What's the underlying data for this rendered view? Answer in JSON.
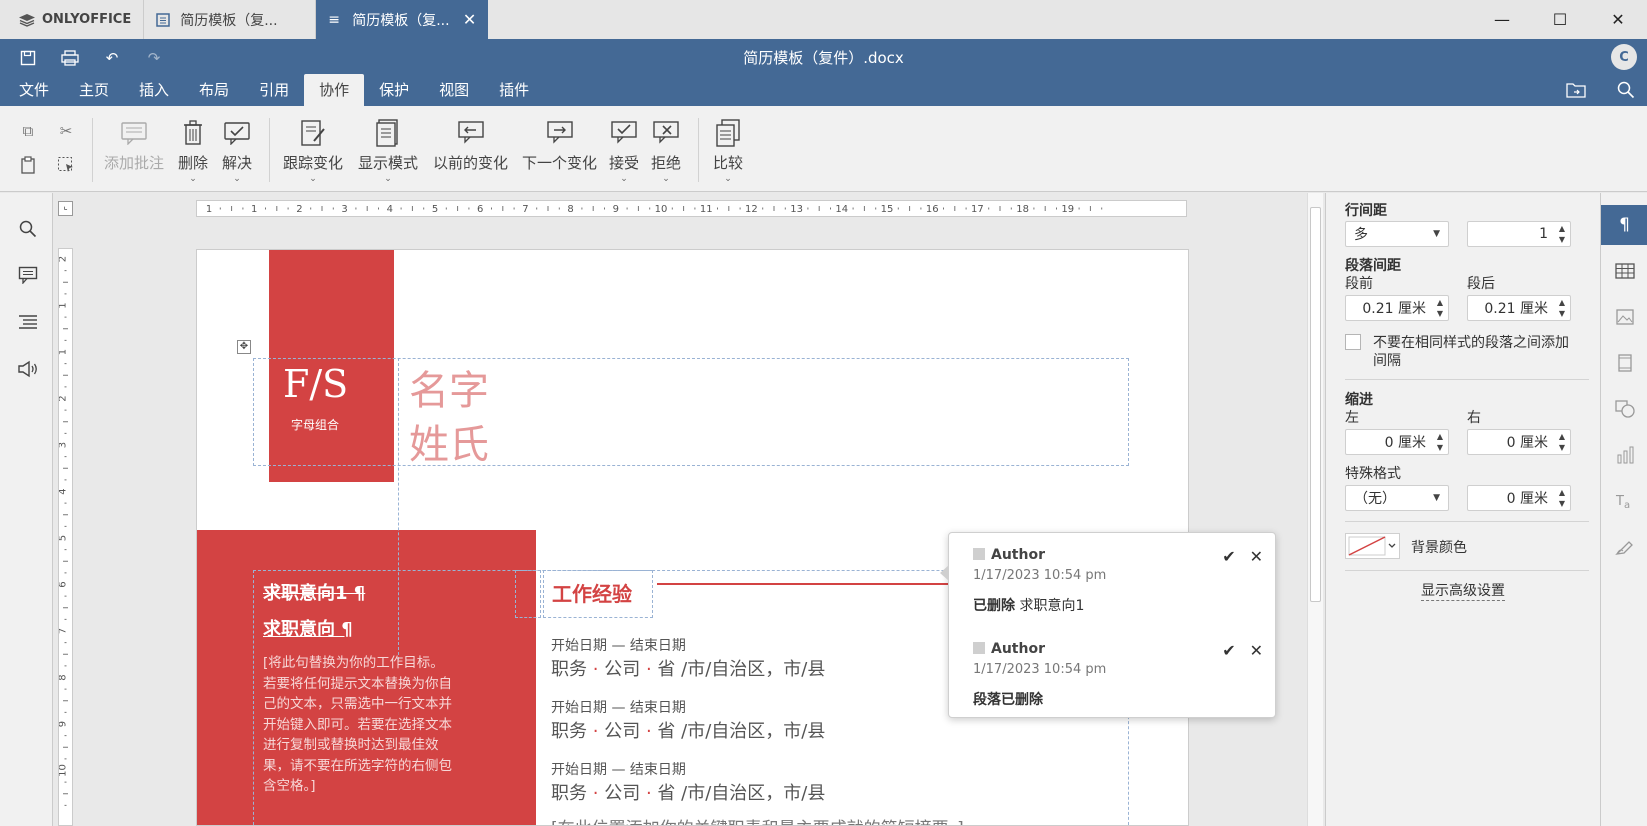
{
  "app": {
    "brand": "ONLYOFFICE"
  },
  "tabs": [
    {
      "label": "简历模板（复...",
      "active": false
    },
    {
      "label": "简历模板（复...",
      "active": true
    }
  ],
  "window": {
    "minimize": "—",
    "maximize": "☐",
    "close": "✕"
  },
  "header": {
    "title": "简历模板（复件）.docx",
    "avatar": "C",
    "menu": [
      "文件",
      "主页",
      "插入",
      "布局",
      "引用",
      "协作",
      "保护",
      "视图",
      "插件"
    ],
    "active_menu": "协作"
  },
  "toolbar": {
    "add_comment": "添加批注",
    "delete": "删除",
    "resolve": "解决",
    "track_changes": "跟踪变化",
    "display_mode": "显示模式",
    "prev_change": "以前的变化",
    "next_change": "下一个变化",
    "accept": "接受",
    "reject": "拒绝",
    "compare": "比较"
  },
  "ruler": {
    "h_labels": [
      "1",
      "1",
      "2",
      "3",
      "4",
      "5",
      "6",
      "7",
      "8",
      "9",
      "10",
      "11",
      "12",
      "13",
      "14",
      "15",
      "16",
      "17",
      "18",
      "19"
    ],
    "v_labels": [
      "2",
      "1",
      "1",
      "2",
      "3",
      "4",
      "5",
      "6",
      "7",
      "8",
      "9",
      "10"
    ]
  },
  "document": {
    "monogram": "F/S",
    "monogram_sub": "字母组合",
    "name_first": "名字",
    "name_last": "姓氏",
    "objective_deleted": "求职意向1 ¶",
    "objective_inserted": "求职意向 ¶",
    "objective_body": "[将此句替换为你的工作目标。若要将任何提示文本替换为你自己的文本，只需选中一行文本并开始键入即可。若要在选择文本进行复制或替换时达到最佳效果，请不要在所选字符的右侧包含空格。]",
    "work_heading": "工作经验",
    "jobs": [
      {
        "dates": "开始日期 — 结束日期",
        "role": "职务",
        "company": "公司",
        "location": "省 /市/自治区，市/县"
      },
      {
        "dates": "开始日期 — 结束日期",
        "role": "职务",
        "company": "公司",
        "location": "省 /市/自治区，市/县"
      },
      {
        "dates": "开始日期 — 结束日期",
        "role": "职务",
        "company": "公司",
        "location": "省 /市/自治区，市/县"
      }
    ],
    "job_more": "[在此位置添加你的关键职责和最主要成就的简短摘要。]"
  },
  "comments": [
    {
      "author": "Author",
      "date": "1/17/2023 10:54 pm",
      "action": "已删除",
      "text": "求职意向1"
    },
    {
      "author": "Author",
      "date": "1/17/2023 10:54 pm",
      "action": "段落已删除",
      "text": ""
    }
  ],
  "right_panel": {
    "line_spacing_label": "行间距",
    "line_spacing_mode": "多",
    "line_spacing_value": "1",
    "para_spacing_label": "段落间距",
    "before_label": "段前",
    "after_label": "段后",
    "before_value": "0.21 厘米",
    "after_value": "0.21 厘米",
    "dont_add_interval_line1": "不要在相同样式的段落之间添加",
    "dont_add_interval_line2": "间隔",
    "indent_label": "缩进",
    "left_label": "左",
    "right_label": "右",
    "left_value": "0 厘米",
    "right_value": "0 厘米",
    "special_label": "特殊格式",
    "special_value": "（无）",
    "special_amount": "0 厘米",
    "bg_color_label": "背景颜色",
    "advanced_link": "显示高级设置"
  },
  "colors": {
    "header_blue": "#446995",
    "resume_red": "#d34343",
    "name_pink": "#e59999"
  }
}
